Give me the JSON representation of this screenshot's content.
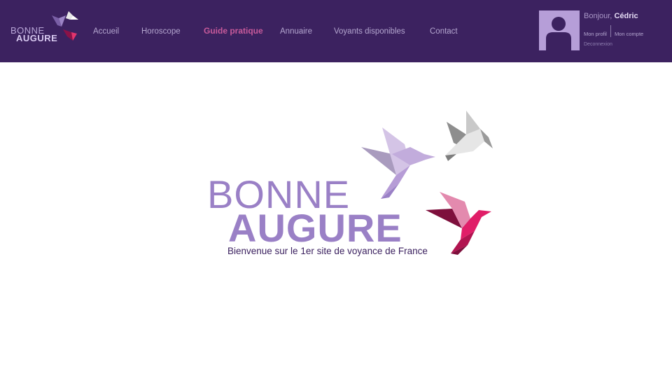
{
  "brand": {
    "line1": "BONNE",
    "line2": "AUGURE"
  },
  "nav": {
    "items": [
      {
        "label": "Accueil",
        "active": false
      },
      {
        "label": "Horoscope",
        "active": false
      },
      {
        "label": "Guide pratique",
        "active": true
      },
      {
        "label": "Annuaire",
        "active": false
      },
      {
        "label": "Voyants disponibles",
        "active": false
      },
      {
        "label": "Contact",
        "active": false
      }
    ]
  },
  "user": {
    "greeting": "Bonjour,",
    "name": "Cédric",
    "profile_link": "Mon profil",
    "account_link": "Mon compte",
    "logout_link": "Deconnexion"
  },
  "hero": {
    "line1": "BONNE",
    "line2": "AUGURE",
    "tagline": "Bienvenue sur le 1er site de voyance de France"
  },
  "colors": {
    "header_bg": "#3c2260",
    "accent": "#c75a9a",
    "brand_purple": "#9a80c6",
    "tagline": "#3c2260",
    "avatar_bg": "#b69ed8"
  },
  "icons": {
    "brand_birds": "origami-birds-icon",
    "avatar": "user-silhouette-icon"
  }
}
